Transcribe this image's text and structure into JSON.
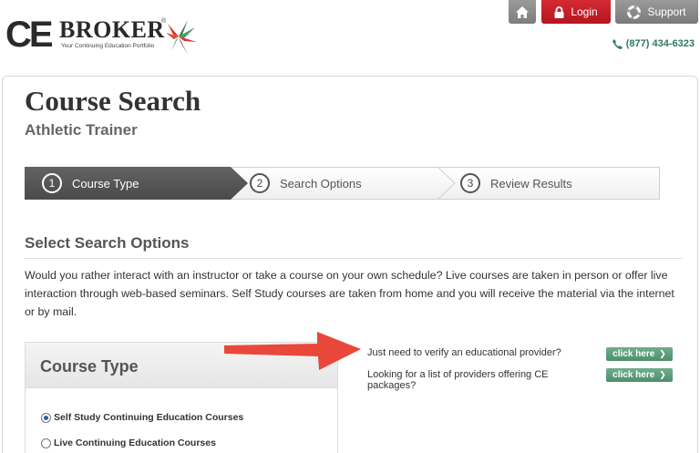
{
  "brand": {
    "logo_ce": "CE",
    "logo_broker": "BROKER",
    "logo_reg": "®",
    "tagline": "Your Continuing Education Portfolio"
  },
  "header": {
    "login_label": "Login",
    "support_label": "Support",
    "phone": "(877) 434-6323"
  },
  "page": {
    "title": "Course Search",
    "subtitle": "Athletic Trainer"
  },
  "steps": [
    {
      "num": "1",
      "label": "Course Type",
      "active": true
    },
    {
      "num": "2",
      "label": "Search Options",
      "active": false
    },
    {
      "num": "3",
      "label": "Review Results",
      "active": false
    }
  ],
  "section": {
    "title": "Select Search Options",
    "intro": "Would you rather interact with an instructor or take a course on your own schedule? Live courses are taken in person or offer live interaction through web-based seminars. Self Study courses are taken from home and you will receive the material via the internet or by mail."
  },
  "course_type": {
    "title": "Course Type",
    "options": [
      {
        "label": "Self Study Continuing Education Courses",
        "selected": true
      },
      {
        "label": "Live Continuing Education Courses",
        "selected": false
      }
    ]
  },
  "links": [
    {
      "question": "Just need to verify an educational provider?",
      "button": "click here"
    },
    {
      "question": "Looking for a list of providers offering CE packages?",
      "button": "click here"
    }
  ],
  "colors": {
    "login_red": "#c41f28",
    "accent_green": "#5a9a76",
    "arrow_red": "#e9473a"
  }
}
